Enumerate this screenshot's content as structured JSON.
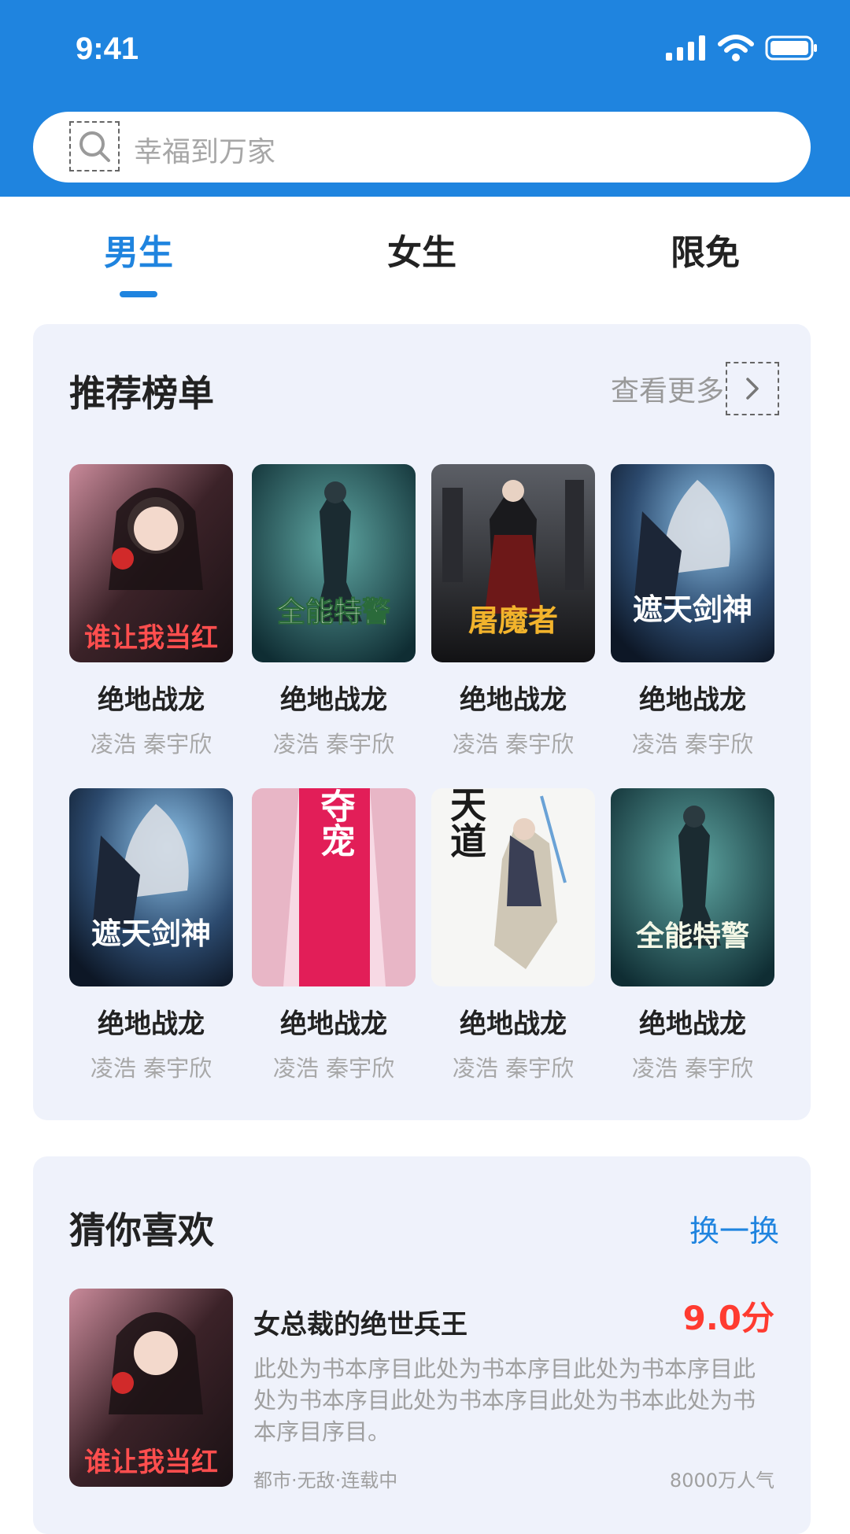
{
  "status": {
    "time": "9:41"
  },
  "search": {
    "placeholder": "幸福到万家"
  },
  "tabs": [
    {
      "label": "男生",
      "active": true
    },
    {
      "label": "女生",
      "active": false
    },
    {
      "label": "限免",
      "active": false
    }
  ],
  "ranking": {
    "title": "推荐榜单",
    "more_label": "查看更多",
    "books": [
      {
        "title": "绝地战龙",
        "author": "凌浩 秦宇欣",
        "cover_text": "谁让我当红"
      },
      {
        "title": "绝地战龙",
        "author": "凌浩 秦宇欣",
        "cover_text": "全能特警"
      },
      {
        "title": "绝地战龙",
        "author": "凌浩 秦宇欣",
        "cover_text": "屠魔者"
      },
      {
        "title": "绝地战龙",
        "author": "凌浩 秦宇欣",
        "cover_text": "遮天剑神"
      },
      {
        "title": "绝地战龙",
        "author": "凌浩 秦宇欣",
        "cover_text": "遮天剑神"
      },
      {
        "title": "绝地战龙",
        "author": "凌浩 秦宇欣",
        "cover_text": "嫡女夺宠"
      },
      {
        "title": "绝地战龙",
        "author": "凌浩 秦宇欣",
        "cover_text": "祭天道"
      },
      {
        "title": "绝地战龙",
        "author": "凌浩 秦宇欣",
        "cover_text": "全能特警"
      }
    ]
  },
  "guess": {
    "title": "猜你喜欢",
    "swap_label": "换一换",
    "item": {
      "cover_text": "谁让我当红",
      "title": "女总裁的绝世兵王",
      "score": "9.0分",
      "description": "此处为书本序目此处为书本序目此处为书本序目此处为书本序目此处为书本序目此处为书本此处为书本序目序目。",
      "tags": "都市·无敌·连载中",
      "popularity": "8000万人气"
    }
  }
}
